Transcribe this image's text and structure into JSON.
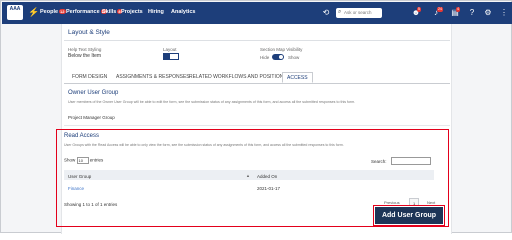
{
  "nav": {
    "logo_text": "AAA",
    "items": [
      {
        "label": "People",
        "badge": "12"
      },
      {
        "label": "Performance",
        "badge": "17"
      },
      {
        "label": "Skills",
        "badge": "8"
      },
      {
        "label": "Projects",
        "badge": ""
      },
      {
        "label": "Hiring",
        "badge": ""
      },
      {
        "label": "Analytics",
        "badge": ""
      }
    ],
    "search_placeholder": "Ask or search",
    "icon_badges": {
      "people": "5",
      "bell": "24",
      "cal": "4"
    }
  },
  "section_title": "Layout & Style",
  "settings": {
    "help_text_label": "Help Text Styling",
    "help_text_value": "Below the Item",
    "layout_label": "Layout",
    "visibility_label": "Section Map Visibility",
    "visibility_hide": "Hide",
    "visibility_show": "Show"
  },
  "tabs": [
    {
      "label": "FORM DESIGN",
      "active": false
    },
    {
      "label": "ASSIGNMENTS & RESPONSES",
      "active": false
    },
    {
      "label": "RELATED WORKFLOWS AND POSITIONS",
      "active": false
    },
    {
      "label": "ACCESS",
      "active": true
    }
  ],
  "owner": {
    "title": "Owner User Group",
    "description": "User members of the Owner User Group will be able to edit the form, see the submission status of any assignments of this form, and access all the submitted responses to this form.",
    "group": "Project Manager Group"
  },
  "read_access": {
    "title": "Read Access",
    "description": "User Groups with the Read Access will be able to only view the form, see the submission status of any assignments of this form, and access all the submitted responses to this form.",
    "show_label": "Show",
    "show_value": "10",
    "entries_label": "entries",
    "search_label": "Search:",
    "columns": [
      "User Group",
      "Added On"
    ],
    "rows": [
      {
        "group": "Finance",
        "added_on": "2021-01-17"
      }
    ],
    "info": "Showing 1 to 1 of 1 entries",
    "pager": {
      "previous": "Previous",
      "page": "1",
      "next": "Next"
    }
  },
  "add_button": "Add User Group",
  "colors": {
    "nav": "#1d3e7a",
    "highlight": "#e3001b",
    "button": "#1d3557",
    "link": "#3a72c8"
  }
}
